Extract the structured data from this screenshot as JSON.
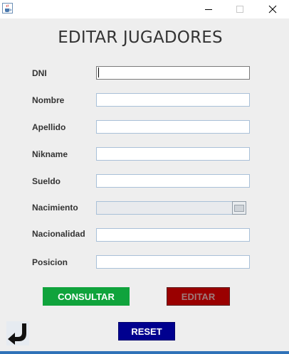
{
  "window": {
    "app_icon": "java-coffee-cup-icon",
    "controls": [
      "minimize-icon",
      "maximize-icon",
      "close-icon"
    ]
  },
  "form": {
    "title": "EDITAR JUGADORES",
    "fields": [
      {
        "label": "DNI",
        "value": ""
      },
      {
        "label": "Nombre",
        "value": ""
      },
      {
        "label": "Apellido",
        "value": ""
      },
      {
        "label": "Nikname",
        "value": ""
      },
      {
        "label": "Sueldo",
        "value": ""
      },
      {
        "label": "Nacimiento",
        "value": ""
      },
      {
        "label": "Nacionalidad",
        "value": ""
      },
      {
        "label": "Posicion",
        "value": ""
      }
    ],
    "date_picker_icon": "calendar-icon"
  },
  "buttons": {
    "consultar": "CONSULTAR",
    "editar": "EDITAR",
    "reset": "RESET",
    "back_icon": "back-arrow-icon"
  },
  "colors": {
    "consultar_bg": "#10a33c",
    "editar_bg": "#9a0000",
    "reset_bg": "#00008f",
    "accent_bar": "#2f72b8"
  }
}
